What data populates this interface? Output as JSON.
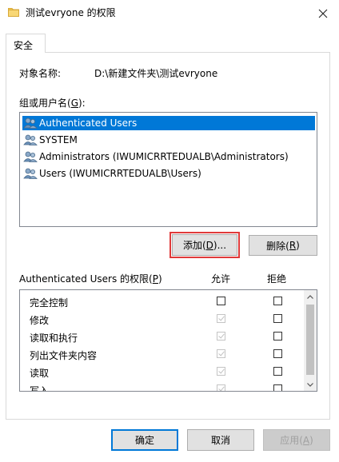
{
  "window": {
    "title": "测试evryone 的权限"
  },
  "tabs": [
    {
      "label": "安全"
    }
  ],
  "object": {
    "label": "对象名称:",
    "value": "D:\\新建文件夹\\测试evryone"
  },
  "group_list": {
    "label_prefix": "组或用户名(",
    "label_key": "G",
    "label_suffix": "):",
    "items": [
      {
        "name": "Authenticated Users",
        "selected": true
      },
      {
        "name": "SYSTEM",
        "selected": false
      },
      {
        "name": "Administrators (IWUMICRRTEDUALB\\Administrators)",
        "selected": false
      },
      {
        "name": "Users (IWUMICRRTEDUALB\\Users)",
        "selected": false
      }
    ]
  },
  "buttons": {
    "add": {
      "prefix": "添加(",
      "key": "D",
      "suffix": ")..."
    },
    "remove": {
      "prefix": "删除(",
      "key": "R",
      "suffix": ")"
    },
    "ok": "确定",
    "cancel": "取消",
    "apply": {
      "prefix": "应用(",
      "key": "A",
      "suffix": ")"
    }
  },
  "permissions": {
    "header_prefix": "Authenticated Users 的权限(",
    "header_key": "P",
    "header_suffix": ")",
    "allow_label": "允许",
    "deny_label": "拒绝",
    "rows": [
      {
        "name": "完全控制",
        "allow": false,
        "allow_disabled": false,
        "deny": false
      },
      {
        "name": "修改",
        "allow": true,
        "allow_disabled": true,
        "deny": false
      },
      {
        "name": "读取和执行",
        "allow": true,
        "allow_disabled": true,
        "deny": false
      },
      {
        "name": "列出文件夹内容",
        "allow": true,
        "allow_disabled": true,
        "deny": false
      },
      {
        "name": "读取",
        "allow": true,
        "allow_disabled": true,
        "deny": false
      },
      {
        "name": "写入",
        "allow": true,
        "allow_disabled": true,
        "deny": false
      }
    ]
  },
  "colors": {
    "selection": "#0078d7",
    "highlight_box": "#e03a3a",
    "button_face": "#e1e1e1"
  }
}
